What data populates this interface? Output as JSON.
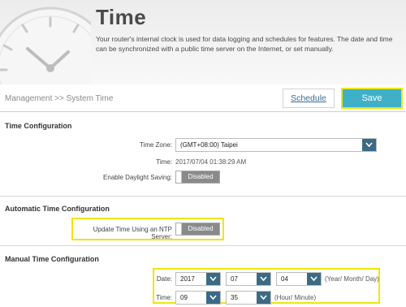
{
  "header": {
    "title": "Time",
    "description": "Your router's internal clock is used for data logging and schedules for features. The date and time can be synchronized with a public time server on the Internet, or set manually.",
    "icon": "clock-icon"
  },
  "breadcrumb": "Management >> System Time",
  "actions": {
    "schedule_label": "Schedule",
    "save_label": "Save"
  },
  "time_config": {
    "title": "Time Configuration",
    "timezone_label": "Time Zone:",
    "timezone_value": "(GMT+08:00) Taipei",
    "time_label": "Time:",
    "time_value": "2017/07/04 01:38:29 AM",
    "dst_label": "Enable Daylight Saving:",
    "dst_state": "Disabled"
  },
  "auto_time": {
    "title": "Automatic Time Configuration",
    "ntp_label": "Update Time Using an NTP Server:",
    "ntp_state": "Disabled"
  },
  "manual_time": {
    "title": "Manual Time Configuration",
    "date_label": "Date:",
    "year": "2017",
    "month": "07",
    "day": "04",
    "date_hint": "(Year/ Month/ Day)",
    "time_label": "Time:",
    "hour": "09",
    "minute": "35",
    "time_hint": "(Hour/ Minute)"
  },
  "colors": {
    "accent": "#3fb0c8",
    "highlight": "#f0e60a",
    "dropdown": "#3c6a84",
    "toggle_off": "#8a8a8a"
  }
}
